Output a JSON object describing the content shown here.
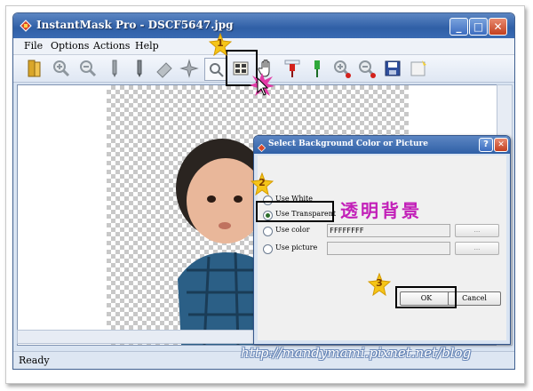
{
  "window": {
    "title": "InstantMask Pro - DSCF5647.jpg",
    "minimize_glyph": "_",
    "maximize_glyph": "□",
    "close_glyph": "✕"
  },
  "menu": [
    "File",
    "Options",
    "Actions",
    "Help"
  ],
  "toolbar": {
    "tools": [
      "open-folder-icon",
      "zoom-in-icon",
      "zoom-out-icon",
      "pencil-gray-icon",
      "pencil-dark-icon",
      "eraser-icon",
      "magic-wand-icon",
      "select-tool-icon",
      "background-grid-icon",
      "hand-pan-icon",
      "red-brush-icon",
      "green-brush-icon",
      "zoom-in-red-icon",
      "zoom-out-red-icon",
      "save-icon",
      "new-note-icon"
    ]
  },
  "status": {
    "text": "Ready"
  },
  "dialog": {
    "title": "Select Background Color or Picture",
    "help_glyph": "?",
    "close_glyph": "✕",
    "options": [
      {
        "label": "Use White",
        "selected": false
      },
      {
        "label": "Use Transparent",
        "selected": true
      },
      {
        "label": "Use color",
        "selected": false
      },
      {
        "label": "Use picture",
        "selected": false
      }
    ],
    "color_value": "FFFFFFFF",
    "picture_value": "",
    "browse_label": "...",
    "ok_label": "OK",
    "cancel_label": "Cancel"
  },
  "annotations": {
    "step_one": "1",
    "step_two": "2",
    "step_three": "3",
    "chinese_note": "透明背景"
  },
  "watermark": "http://mandymami.pixnet.net/blog",
  "colors": {
    "titlebar": "#2f5fa6",
    "annotation": "#c21fb8",
    "highlight_box": "#000000",
    "star": "#f5c518"
  }
}
